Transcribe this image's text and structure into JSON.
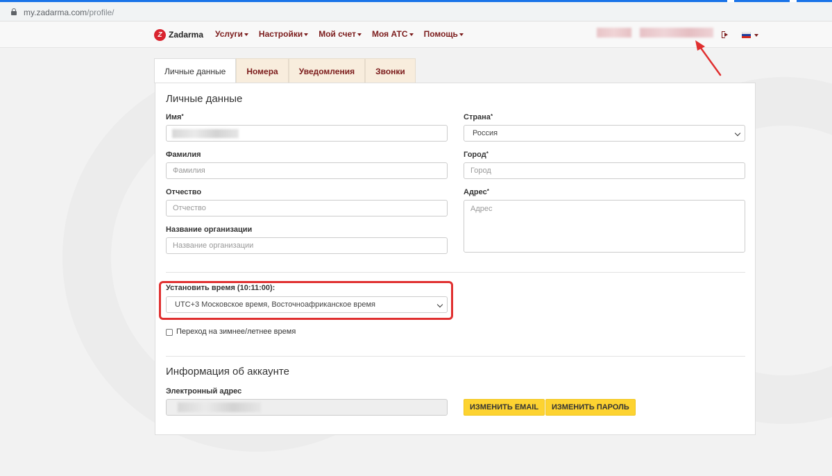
{
  "browser": {
    "url_domain": "my.zadarma.com",
    "url_path": "/profile/"
  },
  "navbar": {
    "logo_mark": "Z",
    "logo_text": "Zadarma",
    "menu": [
      {
        "label": "Услуги"
      },
      {
        "label": "Настройки"
      },
      {
        "label": "Мой счет"
      },
      {
        "label": "Моя АТС"
      },
      {
        "label": "Помощь"
      }
    ],
    "logout_icon": "logout-icon",
    "language_flag": "russia-flag"
  },
  "tabs": [
    {
      "label": "Личные данные",
      "active": true
    },
    {
      "label": "Номера",
      "active": false
    },
    {
      "label": "Уведомления",
      "active": false
    },
    {
      "label": "Звонки",
      "active": false
    }
  ],
  "personal": {
    "title": "Личные данные",
    "first_name_label": "Имя",
    "last_name_label": "Фамилия",
    "last_name_placeholder": "Фамилия",
    "patronymic_label": "Отчество",
    "patronymic_placeholder": "Отчество",
    "org_label": "Название организации",
    "org_placeholder": "Название организации",
    "country_label": "Страна",
    "country_value": "Россия",
    "city_label": "Город",
    "city_placeholder": "Город",
    "address_label": "Адрес",
    "address_placeholder": "Адрес",
    "required_mark": "*"
  },
  "time": {
    "label": "Установить время (10:11:00):",
    "value": "UTC+3 Московское время, Восточноафриканское время",
    "dst_label": "Переход на зимнее/летнее время",
    "dst_checked": false
  },
  "account": {
    "title": "Информация об аккаунте",
    "email_label": "Электронный адрес",
    "change_email_button": "ИЗМЕНИТЬ EMAIL",
    "change_password_button": "ИЗМЕНИТЬ ПАРОЛЬ"
  },
  "colors": {
    "accent": "#7b1b1b",
    "button": "#fdd331",
    "highlight": "#e02f2f",
    "browser_blue": "#1a73e8"
  }
}
